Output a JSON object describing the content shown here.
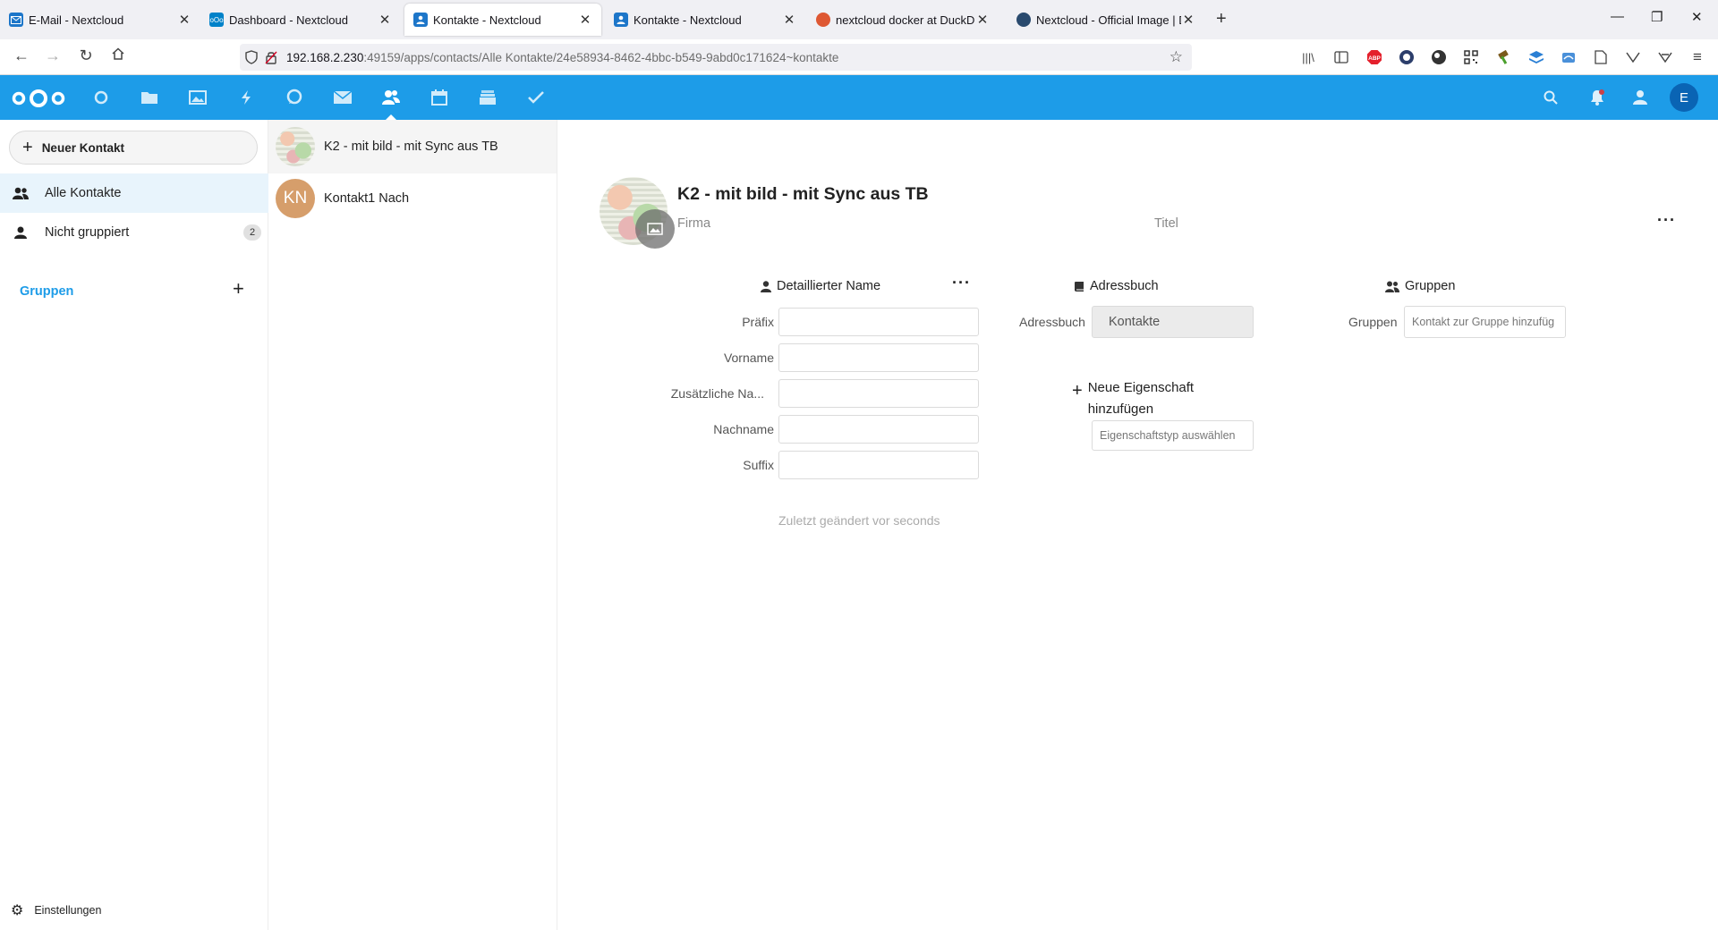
{
  "browser": {
    "tabs": [
      {
        "title": "E-Mail - Nextcloud",
        "icon": "mail-icon"
      },
      {
        "title": "Dashboard - Nextcloud",
        "icon": "nextcloud-icon"
      },
      {
        "title": "Kontakte - Nextcloud",
        "icon": "contacts-icon",
        "active": true
      },
      {
        "title": "Kontakte - Nextcloud",
        "icon": "contacts-icon"
      },
      {
        "title": "nextcloud docker at DuckDuckGo",
        "icon": "duckduckgo-icon"
      },
      {
        "title": "Nextcloud - Official Image | Do",
        "icon": "docker-icon"
      }
    ],
    "url_host": "192.168.2.230",
    "url_rest": ":49159/apps/contacts/Alle Kontakte/24e58934-8462-4bbc-b549-9abd0c171624~kontakte"
  },
  "header": {
    "accent": "#1d9ce8",
    "user_initial": "E"
  },
  "sidebar": {
    "new_contact_label": "Neuer Kontakt",
    "items": [
      {
        "label": "Alle Kontakte",
        "icon": "contacts-icon"
      },
      {
        "label": "Nicht gruppiert",
        "icon": "user-icon",
        "count": "2"
      }
    ],
    "groups_label": "Gruppen",
    "settings_label": "Einstellungen"
  },
  "contacts": [
    {
      "name": "K2 - mit bild - mit Sync aus TB",
      "avatar": "picture"
    },
    {
      "name": "Kontakt1 Nach",
      "initials": "KN",
      "color": "#d69e6b"
    }
  ],
  "detail": {
    "name": "K2 - mit bild - mit Sync aus TB",
    "company_placeholder": "Firma",
    "title_placeholder": "Titel",
    "name_section": {
      "title": "Detaillierter Name",
      "fields": [
        {
          "label": "Präfix",
          "value": ""
        },
        {
          "label": "Vorname",
          "value": ""
        },
        {
          "label": "Zusätzliche Na...",
          "value": ""
        },
        {
          "label": "Nachname",
          "value": ""
        },
        {
          "label": "Suffix",
          "value": ""
        }
      ]
    },
    "addressbook_section": {
      "title": "Adressbuch",
      "label": "Adressbuch",
      "value": "Kontakte"
    },
    "groups_section": {
      "title": "Gruppen",
      "label": "Gruppen",
      "placeholder": "Kontakt zur Gruppe hinzufüg"
    },
    "new_property_label": "Neue Eigenschaft hinzufügen",
    "property_type_placeholder": "Eigenschaftstyp auswählen",
    "last_changed": "Zuletzt geändert vor seconds"
  }
}
